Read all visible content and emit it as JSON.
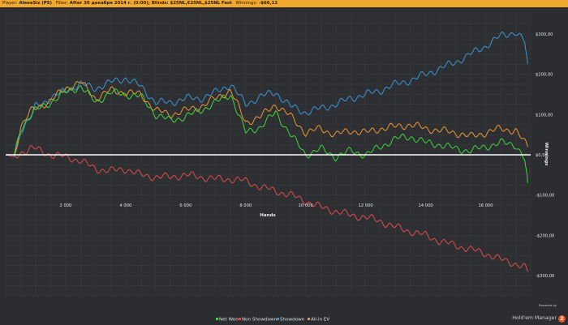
{
  "header": {
    "player_label": "Player:",
    "player_value": "AleeeSiz (PS)",
    "filter_label": "Filter:",
    "filter_value": "After 30 декабря 2014 г. (0:00); Blinds: $25NL,€25NL,$25NL Fast",
    "winnings_label": "Winnings:",
    "winnings_value": "-$66,12"
  },
  "logo": {
    "powered_by": "Powered by",
    "name": "Hold'em Manager",
    "badge": "2"
  },
  "colors": {
    "net_won": "#3ed63a",
    "non_showdown": "#e24a4a",
    "showdown": "#3a95d8",
    "all_in_ev": "#f0962e",
    "zero_line": "#ffffff",
    "grid": "#3a3d41"
  },
  "chart_data": {
    "type": "line",
    "xlabel": "Hands",
    "ylabel": "Winnings",
    "xlim": [
      0,
      17500
    ],
    "ylim": [
      -350,
      350
    ],
    "x_ticks": [
      2000,
      4000,
      6000,
      8000,
      10000,
      12000,
      14000,
      16000
    ],
    "x_tick_labels": [
      "2 000",
      "4 000",
      "6 000",
      "8 000",
      "10 000",
      "12 000",
      "14 000",
      "16 000"
    ],
    "y_ticks": [
      300,
      200,
      100,
      0,
      -100,
      -200,
      -300
    ],
    "y_tick_labels": [
      "$300,00",
      "$200,00",
      "$100,00",
      "$0,00",
      "-$100,00",
      "-$200,00",
      "-$300,00"
    ],
    "grid": true,
    "legend_position": "bottom-center",
    "x": [
      0,
      300,
      500,
      800,
      1000,
      1500,
      2000,
      2500,
      3000,
      3500,
      4000,
      4500,
      5000,
      5500,
      6000,
      6500,
      7000,
      7500,
      8000,
      8500,
      9000,
      9500,
      10000,
      10500,
      11000,
      11500,
      12000,
      12500,
      13000,
      13500,
      14000,
      14500,
      15000,
      15500,
      16000,
      16500,
      17000,
      17300,
      17400
    ],
    "series": [
      {
        "name": "Net Won",
        "color": "#3ed63a",
        "values": [
          0,
          0,
          65,
          95,
          110,
          130,
          155,
          170,
          130,
          155,
          150,
          145,
          100,
          85,
          95,
          110,
          130,
          150,
          55,
          70,
          105,
          50,
          0,
          15,
          -5,
          10,
          0,
          20,
          40,
          45,
          30,
          25,
          15,
          10,
          20,
          30,
          25,
          -10,
          -70
        ]
      },
      {
        "name": "Non Showdown",
        "color": "#e24a4a",
        "values": [
          0,
          -5,
          5,
          15,
          15,
          0,
          -5,
          -15,
          -35,
          -40,
          -35,
          -50,
          -55,
          -55,
          -50,
          -55,
          -60,
          -60,
          -65,
          -80,
          -90,
          -100,
          -115,
          -130,
          -140,
          -150,
          -155,
          -165,
          -180,
          -190,
          -200,
          -215,
          -225,
          -235,
          -245,
          -260,
          -270,
          -280,
          -290
        ]
      },
      {
        "name": "Showdown",
        "color": "#3a95d8",
        "values": [
          0,
          0,
          60,
          90,
          120,
          140,
          160,
          175,
          165,
          180,
          190,
          170,
          130,
          130,
          140,
          140,
          155,
          175,
          125,
          145,
          155,
          120,
          105,
          115,
          125,
          140,
          150,
          160,
          175,
          185,
          200,
          215,
          230,
          250,
          270,
          295,
          305,
          280,
          225
        ]
      },
      {
        "name": "All-in EV",
        "color": "#f0962e",
        "values": [
          0,
          0,
          70,
          105,
          115,
          135,
          165,
          180,
          140,
          160,
          155,
          150,
          110,
          100,
          110,
          120,
          140,
          160,
          80,
          95,
          125,
          95,
          55,
          65,
          50,
          60,
          55,
          65,
          70,
          75,
          65,
          60,
          55,
          45,
          55,
          65,
          60,
          30,
          20
        ]
      }
    ]
  }
}
